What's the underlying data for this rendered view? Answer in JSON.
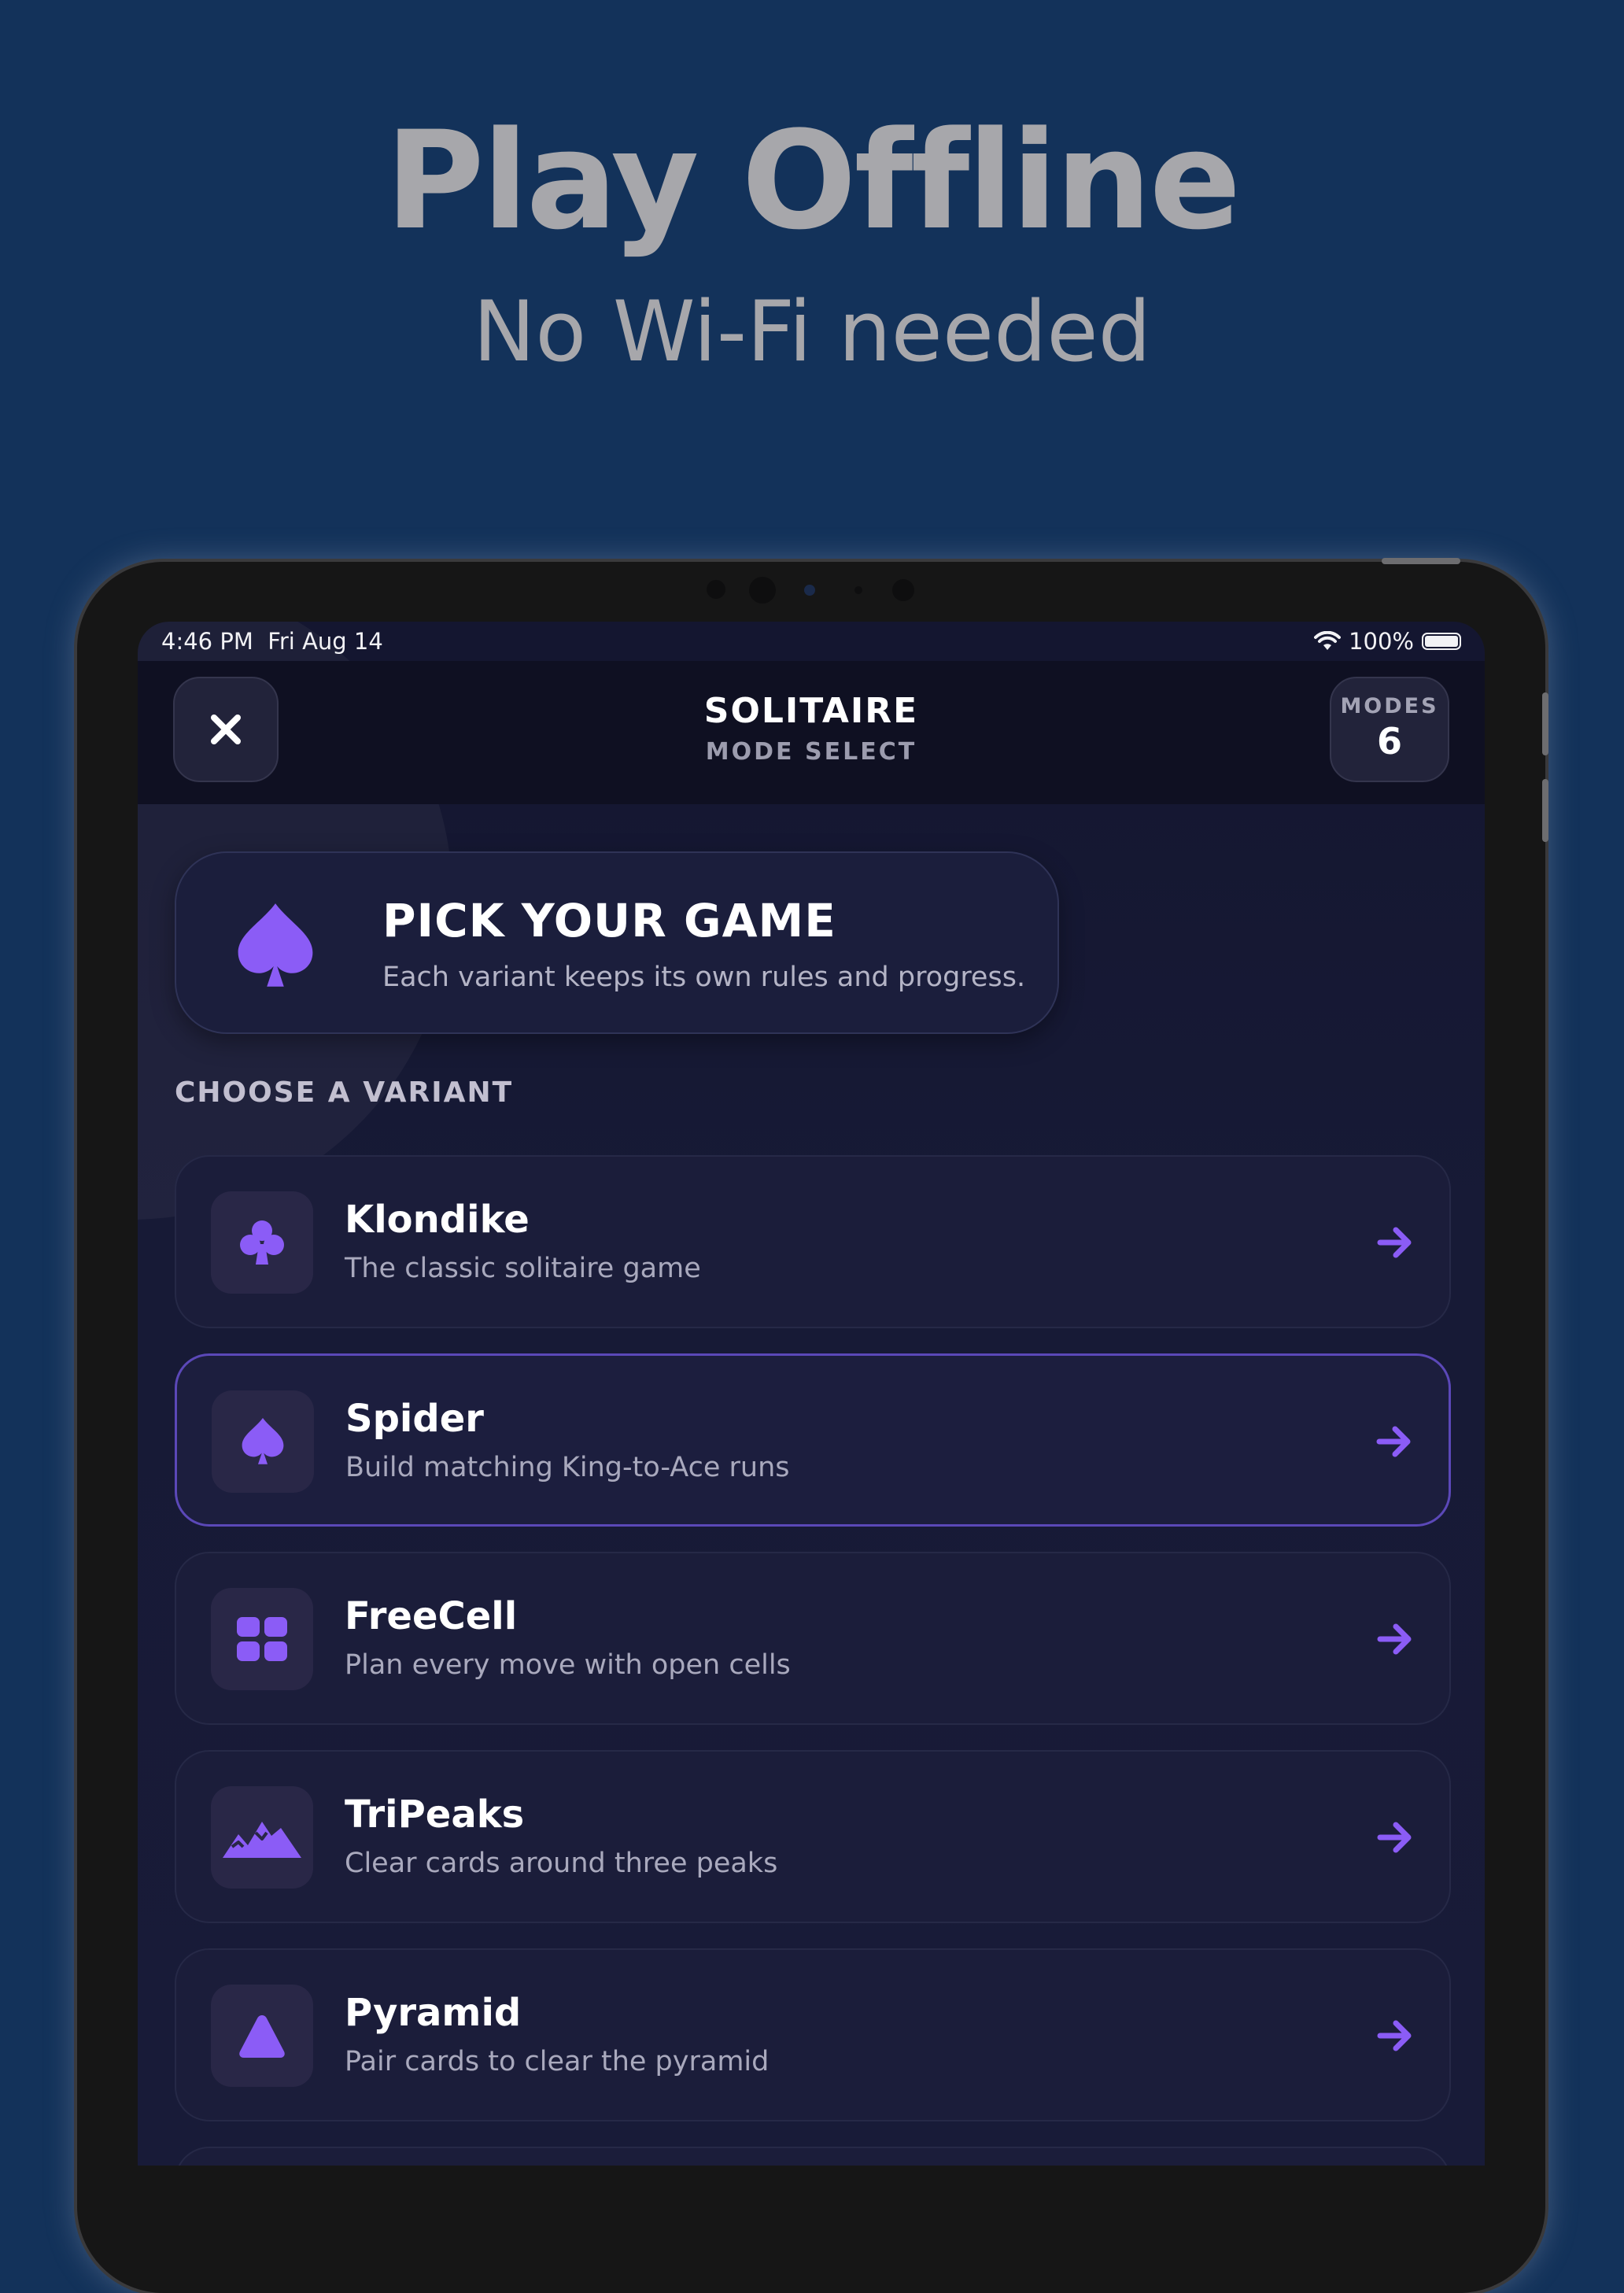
{
  "promo": {
    "title": "Play Offline",
    "subtitle": "No Wi-Fi needed"
  },
  "status_bar": {
    "time": "4:46 PM",
    "date": "Fri Aug 14",
    "battery": "100%"
  },
  "header": {
    "title": "SOLITAIRE",
    "subtitle": "MODE SELECT",
    "modes_label": "MODES",
    "modes_count": "6"
  },
  "hero": {
    "title": "PICK YOUR GAME",
    "description": "Each variant keeps its own rules and progress.",
    "icon": "spade-icon"
  },
  "section_label": "CHOOSE A VARIANT",
  "variants": [
    {
      "name": "Klondike",
      "description": "The classic solitaire game",
      "icon": "club-icon"
    },
    {
      "name": "Spider",
      "description": "Build matching King-to-Ace runs",
      "icon": "spade-icon",
      "selected": true
    },
    {
      "name": "FreeCell",
      "description": "Plan every move with open cells",
      "icon": "grid-icon"
    },
    {
      "name": "TriPeaks",
      "description": "Clear cards around three peaks",
      "icon": "mountains-icon"
    },
    {
      "name": "Pyramid",
      "description": "Pair cards to clear the pyramid",
      "icon": "triangle-icon"
    }
  ],
  "colors": {
    "background": "#13325a",
    "accent": "#8b5cf6",
    "screen_bg": "#171a36"
  }
}
